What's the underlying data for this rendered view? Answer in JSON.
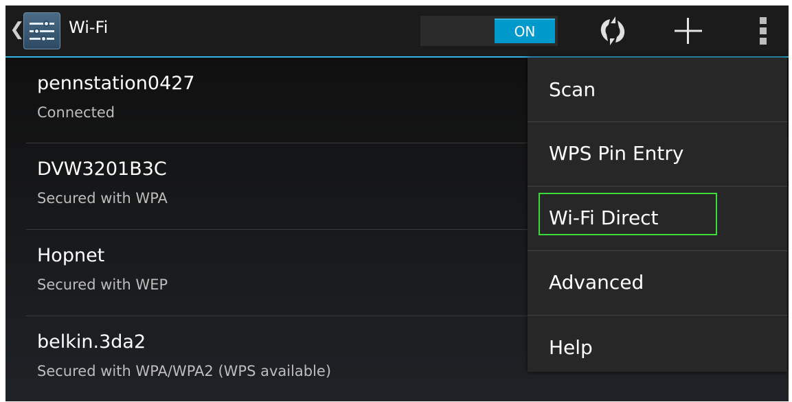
{
  "actionbar": {
    "up_caret": "❮",
    "app_icon": "wifi-settings-icon",
    "title": "Wi-Fi",
    "toggle_label": "ON",
    "toggle_state": true,
    "icons": [
      "wps-push-icon",
      "add-network-icon",
      "overflow-menu-icon"
    ],
    "accent_color": "#33b5e5"
  },
  "networks": [
    {
      "name": "pennstation0427",
      "status": "Connected"
    },
    {
      "name": "DVW3201B3C",
      "status": "Secured with WPA"
    },
    {
      "name": "Hopnet",
      "status": "Secured with WEP"
    },
    {
      "name": "belkin.3da2",
      "status": "Secured with WPA/WPA2 (WPS available)"
    }
  ],
  "menu": {
    "items": [
      {
        "label": "Scan"
      },
      {
        "label": "WPS Pin Entry"
      },
      {
        "label": "Wi-Fi Direct"
      },
      {
        "label": "Advanced"
      },
      {
        "label": "Help"
      }
    ],
    "highlighted": "Wi-Fi Direct",
    "highlight_color": "#3bdc3b"
  }
}
